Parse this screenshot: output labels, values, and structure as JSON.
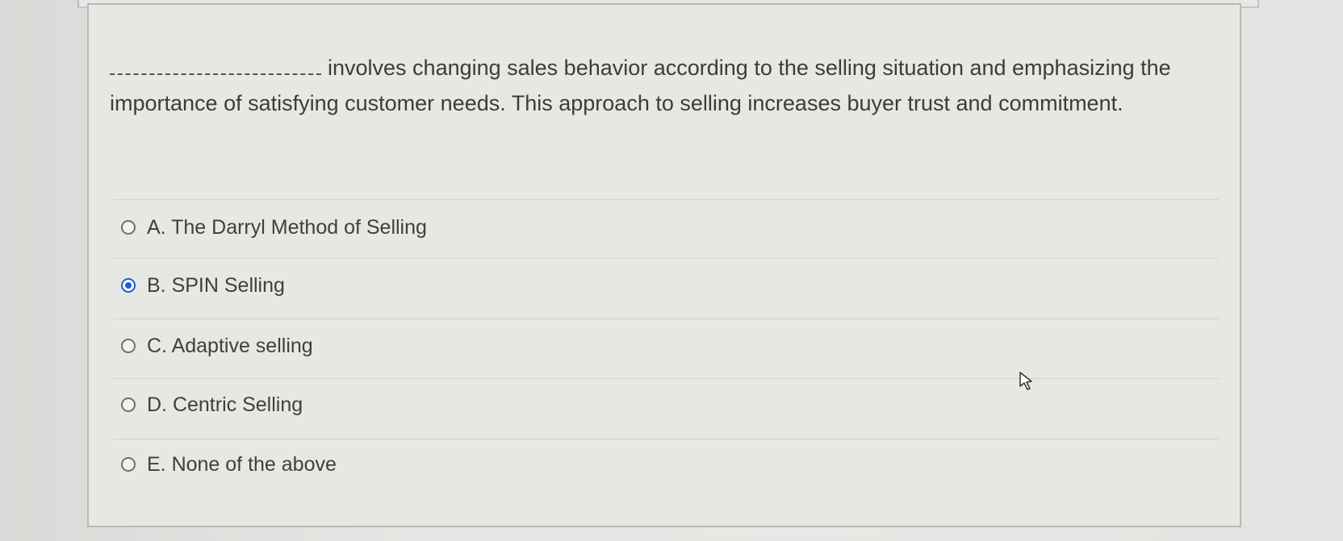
{
  "question": {
    "blank_label": "________________",
    "text": "involves changing sales behavior according to the selling situation and emphasizing the importance of satisfying customer needs. This approach to selling increases buyer trust and commitment."
  },
  "options": [
    {
      "label": "A. The Darryl Method of Selling",
      "selected": false
    },
    {
      "label": "B. SPIN Selling",
      "selected": true
    },
    {
      "label": "C. Adaptive selling",
      "selected": false
    },
    {
      "label": "D. Centric Selling",
      "selected": false
    },
    {
      "label": "E. None of the above",
      "selected": false
    }
  ],
  "colors": {
    "selected_radio": "#1a5fd0",
    "text": "#3c3d3b"
  },
  "icons": {
    "cursor": "mouse-pointer-icon"
  }
}
